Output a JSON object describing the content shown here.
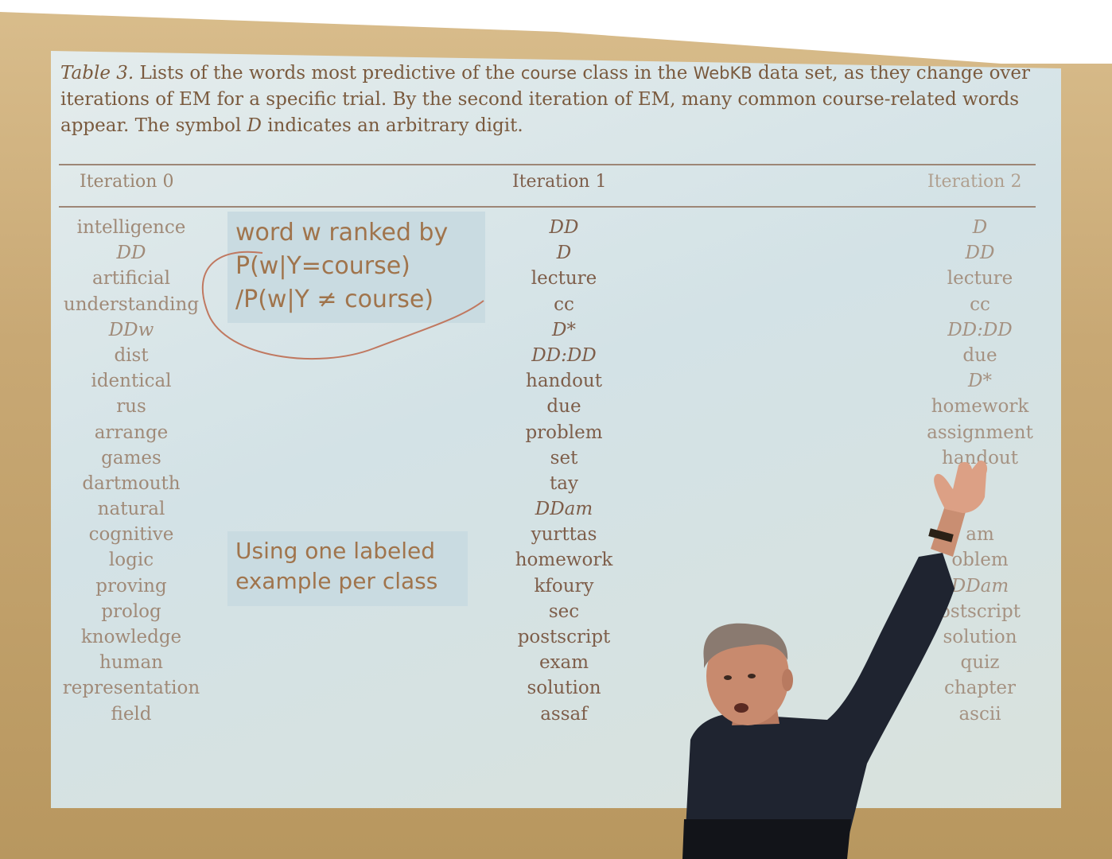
{
  "caption": {
    "lead": "Table 3.",
    "part1": "Lists of the words most predictive of the",
    "course_word": "course",
    "part2": "class in the",
    "webkb": "WebKB",
    "part3": "data set, as they change over iterations of EM for a specific trial. By the second iteration of EM, many common course-related words appear. The symbol",
    "symbol": "D",
    "part4": "indicates an arbitrary digit."
  },
  "table": {
    "headers": [
      "Iteration 0",
      "Iteration 1",
      "Iteration 2"
    ],
    "iteration0": [
      "intelligence",
      "DD",
      "artificial",
      "understanding",
      "DDw",
      "dist",
      "identical",
      "rus",
      "arrange",
      "games",
      "dartmouth",
      "natural",
      "cognitive",
      "logic",
      "proving",
      "prolog",
      "knowledge",
      "human",
      "representation",
      "field"
    ],
    "iteration1": [
      "DD",
      "D",
      "lecture",
      "cc",
      "D*",
      "DD:DD",
      "handout",
      "due",
      "problem",
      "set",
      "tay",
      "DDam",
      "yurttas",
      "homework",
      "kfoury",
      "sec",
      "postscript",
      "exam",
      "solution",
      "assaf"
    ],
    "iteration2": [
      "D",
      "DD",
      "lecture",
      "cc",
      "DD:DD",
      "due",
      "D*",
      "homework",
      "assignment",
      "handout",
      "",
      "",
      "am",
      "oblem",
      "DDam",
      "ostscript",
      "solution",
      "quiz",
      "chapter",
      "ascii"
    ]
  },
  "annotations": {
    "note1": [
      "word w ranked by",
      "P(w|Y=course)",
      "/P(w|Y ≠ course)"
    ],
    "note2": [
      "Using one labeled",
      "example per class"
    ]
  }
}
